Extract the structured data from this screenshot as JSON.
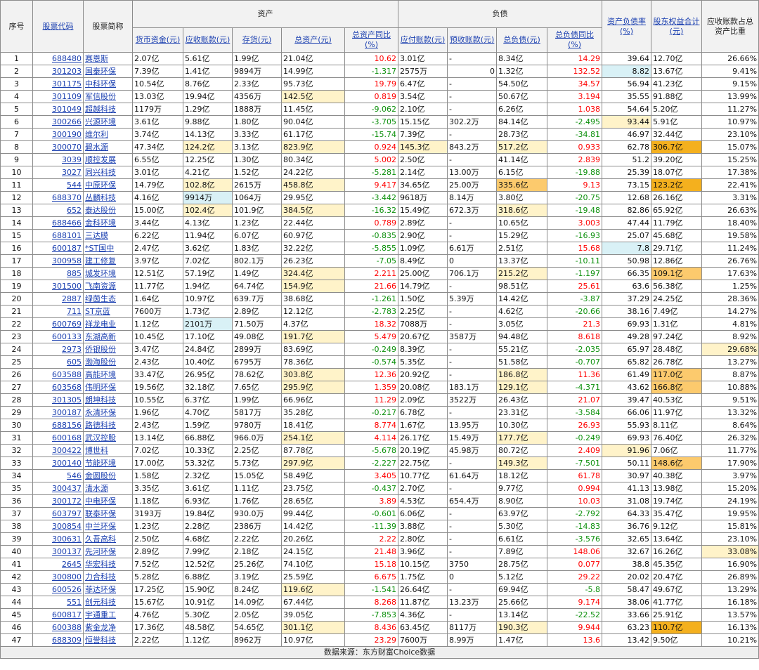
{
  "header": {
    "seq": "序号",
    "code": "股票代码",
    "name": "股票简称",
    "group_assets": "资产",
    "group_liab": "负债",
    "debt_ratio": "资产负债率(%)",
    "equity_total": "股东权益合计(元)",
    "recv_ratio": "应收账款占总资产比重",
    "cols": [
      "货币资金(元)",
      "应收账款(元)",
      "存货(元)",
      "总资产(元)",
      "总资产同比(%)",
      "应付账款(元)",
      "预收账款(元)",
      "总负债(元)",
      "总负债同比(%)"
    ]
  },
  "footer": "数据来源：东方财富Choice数据",
  "colors": {
    "highlight_yellow": "#fff3c9",
    "highlight_orange": "#fcca6d",
    "highlight_dark_orange": "#f4b01e",
    "highlight_cyan": "#d9f1f6",
    "positive": "#ff0000",
    "negative": "#0a8f0a"
  },
  "rows": [
    {
      "seq": "1",
      "code": "688480",
      "name": "赛恩斯",
      "cash": "2.07亿",
      "recv": "5.61亿",
      "inv": "1.99亿",
      "ta": "21.04亿",
      "tay": "10.62",
      "ap": "3.01亿",
      "adv": "-",
      "tl": "8.34亿",
      "tly": "14.29",
      "dr": "39.64",
      "eq": "12.70亿",
      "rr": "26.66%"
    },
    {
      "seq": "2",
      "code": "301203",
      "name": "国泰环保",
      "cash": "7.39亿",
      "recv": "1.41亿",
      "inv": "9894万",
      "ta": "14.99亿",
      "tay": "-1.317",
      "ap": "2575万",
      "adv": "0",
      "tl": "1.32亿",
      "tly": "132.52",
      "dr": "8.82",
      "eq": "13.67亿",
      "rr": "9.41%"
    },
    {
      "seq": "3",
      "code": "301175",
      "name": "中科环保",
      "cash": "10.54亿",
      "recv": "8.76亿",
      "inv": "2.33亿",
      "ta": "95.73亿",
      "tay": "19.79",
      "ap": "6.47亿",
      "adv": "-",
      "tl": "54.50亿",
      "tly": "34.57",
      "dr": "56.94",
      "eq": "41.23亿",
      "rr": "9.15%"
    },
    {
      "seq": "4",
      "code": "301109",
      "name": "军信股份",
      "cash": "13.03亿",
      "recv": "19.94亿",
      "inv": "4356万",
      "ta": "142.5亿",
      "tay": "0.819",
      "ap": "3.54亿",
      "adv": "-",
      "tl": "50.67亿",
      "tly": "3.194",
      "dr": "35.55",
      "eq": "91.88亿",
      "rr": "13.99%"
    },
    {
      "seq": "5",
      "code": "301049",
      "name": "超越科技",
      "cash": "1179万",
      "recv": "1.29亿",
      "inv": "1888万",
      "ta": "11.45亿",
      "tay": "-9.062",
      "ap": "2.10亿",
      "adv": "-",
      "tl": "6.26亿",
      "tly": "1.038",
      "dr": "54.64",
      "eq": "5.20亿",
      "rr": "11.27%"
    },
    {
      "seq": "6",
      "code": "300266",
      "name": "兴源环境",
      "cash": "3.61亿",
      "recv": "9.88亿",
      "inv": "1.80亿",
      "ta": "90.04亿",
      "tay": "-3.705",
      "ap": "15.15亿",
      "adv": "302.2万",
      "tl": "84.14亿",
      "tly": "-2.495",
      "dr": "93.44",
      "eq": "5.91亿",
      "rr": "10.97%"
    },
    {
      "seq": "7",
      "code": "300190",
      "name": "维尔利",
      "cash": "3.74亿",
      "recv": "14.13亿",
      "inv": "3.33亿",
      "ta": "61.17亿",
      "tay": "-15.74",
      "ap": "7.39亿",
      "adv": "-",
      "tl": "28.73亿",
      "tly": "-34.81",
      "dr": "46.97",
      "eq": "32.44亿",
      "rr": "23.10%"
    },
    {
      "seq": "8",
      "code": "300070",
      "name": "碧水源",
      "cash": "47.34亿",
      "recv": "124.2亿",
      "inv": "3.13亿",
      "ta": "823.9亿",
      "tay": "0.924",
      "ap": "145.3亿",
      "adv": "843.2万",
      "tl": "517.2亿",
      "tly": "0.933",
      "dr": "62.78",
      "eq": "306.7亿",
      "rr": "15.07%"
    },
    {
      "seq": "9",
      "code": "3039",
      "name": "顺控发展",
      "cash": "6.55亿",
      "recv": "12.25亿",
      "inv": "1.30亿",
      "ta": "80.34亿",
      "tay": "5.002",
      "ap": "2.50亿",
      "adv": "-",
      "tl": "41.14亿",
      "tly": "2.839",
      "dr": "51.2",
      "eq": "39.20亿",
      "rr": "15.25%"
    },
    {
      "seq": "10",
      "code": "3027",
      "name": "同兴科技",
      "cash": "3.01亿",
      "recv": "4.21亿",
      "inv": "1.52亿",
      "ta": "24.22亿",
      "tay": "-5.281",
      "ap": "2.14亿",
      "adv": "13.00万",
      "tl": "6.15亿",
      "tly": "-19.88",
      "dr": "25.39",
      "eq": "18.07亿",
      "rr": "17.38%"
    },
    {
      "seq": "11",
      "code": "544",
      "name": "中原环保",
      "cash": "14.79亿",
      "recv": "102.8亿",
      "inv": "2615万",
      "ta": "458.8亿",
      "tay": "9.417",
      "ap": "34.65亿",
      "adv": "25.00万",
      "tl": "335.6亿",
      "tly": "9.13",
      "dr": "73.15",
      "eq": "123.2亿",
      "rr": "22.41%"
    },
    {
      "seq": "12",
      "code": "688370",
      "name": "丛麟科技",
      "cash": "4.16亿",
      "recv": "9914万",
      "inv": "1064万",
      "ta": "29.95亿",
      "tay": "-3.442",
      "ap": "9618万",
      "adv": "8.14万",
      "tl": "3.80亿",
      "tly": "-20.75",
      "dr": "12.68",
      "eq": "26.16亿",
      "rr": "3.31%"
    },
    {
      "seq": "13",
      "code": "652",
      "name": "泰达股份",
      "cash": "15.00亿",
      "recv": "102.4亿",
      "inv": "101.9亿",
      "ta": "384.5亿",
      "tay": "-16.32",
      "ap": "15.49亿",
      "adv": "672.3万",
      "tl": "318.6亿",
      "tly": "-19.48",
      "dr": "82.86",
      "eq": "65.92亿",
      "rr": "26.63%"
    },
    {
      "seq": "14",
      "code": "688466",
      "name": "金科环境",
      "cash": "3.44亿",
      "recv": "4.13亿",
      "inv": "1.23亿",
      "ta": "22.44亿",
      "tay": "0.789",
      "ap": "2.89亿",
      "adv": "-",
      "tl": "10.65亿",
      "tly": "3.003",
      "dr": "47.44",
      "eq": "11.79亿",
      "rr": "18.40%"
    },
    {
      "seq": "15",
      "code": "688101",
      "name": "三达膜",
      "cash": "6.22亿",
      "recv": "11.94亿",
      "inv": "6.07亿",
      "ta": "60.97亿",
      "tay": "-0.835",
      "ap": "2.90亿",
      "adv": "-",
      "tl": "15.29亿",
      "tly": "-16.93",
      "dr": "25.07",
      "eq": "45.68亿",
      "rr": "19.58%"
    },
    {
      "seq": "16",
      "code": "600187",
      "name": "*ST国中",
      "cash": "2.47亿",
      "recv": "3.62亿",
      "inv": "1.83亿",
      "ta": "32.22亿",
      "tay": "-5.855",
      "ap": "1.09亿",
      "adv": "6.61万",
      "tl": "2.51亿",
      "tly": "15.68",
      "dr": "7.8",
      "eq": "29.71亿",
      "rr": "11.24%"
    },
    {
      "seq": "17",
      "code": "300958",
      "name": "建工修复",
      "cash": "3.97亿",
      "recv": "7.02亿",
      "inv": "802.1万",
      "ta": "26.23亿",
      "tay": "-7.05",
      "ap": "8.49亿",
      "adv": "0",
      "tl": "13.37亿",
      "tly": "-10.11",
      "dr": "50.98",
      "eq": "12.86亿",
      "rr": "26.76%"
    },
    {
      "seq": "18",
      "code": "885",
      "name": "城发环境",
      "cash": "12.51亿",
      "recv": "57.19亿",
      "inv": "1.49亿",
      "ta": "324.4亿",
      "tay": "2.211",
      "ap": "25.00亿",
      "adv": "706.1万",
      "tl": "215.2亿",
      "tly": "-1.197",
      "dr": "66.35",
      "eq": "109.1亿",
      "rr": "17.63%"
    },
    {
      "seq": "19",
      "code": "301500",
      "name": "飞南资源",
      "cash": "11.77亿",
      "recv": "1.94亿",
      "inv": "64.74亿",
      "ta": "154.9亿",
      "tay": "21.66",
      "ap": "14.79亿",
      "adv": "-",
      "tl": "98.51亿",
      "tly": "25.61",
      "dr": "63.6",
      "eq": "56.38亿",
      "rr": "1.25%"
    },
    {
      "seq": "20",
      "code": "2887",
      "name": "绿茵生态",
      "cash": "1.64亿",
      "recv": "10.97亿",
      "inv": "639.7万",
      "ta": "38.68亿",
      "tay": "-1.261",
      "ap": "1.50亿",
      "adv": "5.39万",
      "tl": "14.42亿",
      "tly": "-3.87",
      "dr": "37.29",
      "eq": "24.25亿",
      "rr": "28.36%"
    },
    {
      "seq": "21",
      "code": "711",
      "name": "ST京蓝",
      "cash": "7600万",
      "recv": "1.73亿",
      "inv": "2.89亿",
      "ta": "12.12亿",
      "tay": "-2.783",
      "ap": "2.25亿",
      "adv": "-",
      "tl": "4.62亿",
      "tly": "-20.66",
      "dr": "38.16",
      "eq": "7.49亿",
      "rr": "14.27%"
    },
    {
      "seq": "22",
      "code": "600769",
      "name": "祥龙电业",
      "cash": "1.12亿",
      "recv": "2101万",
      "inv": "71.50万",
      "ta": "4.37亿",
      "tay": "18.32",
      "ap": "7088万",
      "adv": "-",
      "tl": "3.05亿",
      "tly": "21.3",
      "dr": "69.93",
      "eq": "1.31亿",
      "rr": "4.81%"
    },
    {
      "seq": "23",
      "code": "600133",
      "name": "东湖高新",
      "cash": "10.45亿",
      "recv": "17.10亿",
      "inv": "49.08亿",
      "ta": "191.7亿",
      "tay": "5.479",
      "ap": "20.67亿",
      "adv": "3587万",
      "tl": "94.48亿",
      "tly": "8.618",
      "dr": "49.28",
      "eq": "97.24亿",
      "rr": "8.92%"
    },
    {
      "seq": "24",
      "code": "2973",
      "name": "侨银股份",
      "cash": "3.47亿",
      "recv": "24.84亿",
      "inv": "2899万",
      "ta": "83.69亿",
      "tay": "-0.249",
      "ap": "8.39亿",
      "adv": "-",
      "tl": "55.21亿",
      "tly": "-2.035",
      "dr": "65.97",
      "eq": "28.48亿",
      "rr": "29.68%"
    },
    {
      "seq": "25",
      "code": "605",
      "name": "渤海股份",
      "cash": "2.43亿",
      "recv": "10.40亿",
      "inv": "6795万",
      "ta": "78.36亿",
      "tay": "-0.574",
      "ap": "5.35亿",
      "adv": "-",
      "tl": "51.58亿",
      "tly": "-0.707",
      "dr": "65.82",
      "eq": "26.78亿",
      "rr": "13.27%"
    },
    {
      "seq": "26",
      "code": "603588",
      "name": "高能环境",
      "cash": "33.47亿",
      "recv": "26.95亿",
      "inv": "78.62亿",
      "ta": "303.8亿",
      "tay": "12.36",
      "ap": "20.92亿",
      "adv": "-",
      "tl": "186.8亿",
      "tly": "11.36",
      "dr": "61.49",
      "eq": "117.0亿",
      "rr": "8.87%"
    },
    {
      "seq": "27",
      "code": "603568",
      "name": "伟明环保",
      "cash": "19.56亿",
      "recv": "32.18亿",
      "inv": "7.65亿",
      "ta": "295.9亿",
      "tay": "1.359",
      "ap": "20.08亿",
      "adv": "183.1万",
      "tl": "129.1亿",
      "tly": "-4.371",
      "dr": "43.62",
      "eq": "166.8亿",
      "rr": "10.88%"
    },
    {
      "seq": "28",
      "code": "301305",
      "name": "朗坤科技",
      "cash": "10.55亿",
      "recv": "6.37亿",
      "inv": "1.99亿",
      "ta": "66.96亿",
      "tay": "11.29",
      "ap": "2.09亿",
      "adv": "3522万",
      "tl": "26.43亿",
      "tly": "21.07",
      "dr": "39.47",
      "eq": "40.53亿",
      "rr": "9.51%"
    },
    {
      "seq": "29",
      "code": "300187",
      "name": "永清环保",
      "cash": "1.96亿",
      "recv": "4.70亿",
      "inv": "5817万",
      "ta": "35.28亿",
      "tay": "-0.217",
      "ap": "6.78亿",
      "adv": "-",
      "tl": "23.31亿",
      "tly": "-3.584",
      "dr": "66.06",
      "eq": "11.97亿",
      "rr": "13.32%"
    },
    {
      "seq": "30",
      "code": "688156",
      "name": "路德科技",
      "cash": "2.43亿",
      "recv": "1.59亿",
      "inv": "9780万",
      "ta": "18.41亿",
      "tay": "8.774",
      "ap": "1.67亿",
      "adv": "13.95万",
      "tl": "10.30亿",
      "tly": "26.93",
      "dr": "55.93",
      "eq": "8.11亿",
      "rr": "8.64%"
    },
    {
      "seq": "31",
      "code": "600168",
      "name": "武汉控股",
      "cash": "13.14亿",
      "recv": "66.88亿",
      "inv": "966.0万",
      "ta": "254.1亿",
      "tay": "4.114",
      "ap": "26.17亿",
      "adv": "15.49万",
      "tl": "177.7亿",
      "tly": "-0.249",
      "dr": "69.93",
      "eq": "76.40亿",
      "rr": "26.32%"
    },
    {
      "seq": "32",
      "code": "300422",
      "name": "博世科",
      "cash": "7.02亿",
      "recv": "10.33亿",
      "inv": "2.25亿",
      "ta": "87.78亿",
      "tay": "-5.678",
      "ap": "20.19亿",
      "adv": "45.98万",
      "tl": "80.72亿",
      "tly": "2.409",
      "dr": "91.96",
      "eq": "7.06亿",
      "rr": "11.77%"
    },
    {
      "seq": "33",
      "code": "300140",
      "name": "节能环境",
      "cash": "17.00亿",
      "recv": "53.32亿",
      "inv": "5.73亿",
      "ta": "297.9亿",
      "tay": "-2.227",
      "ap": "22.75亿",
      "adv": "-",
      "tl": "149.3亿",
      "tly": "-7.501",
      "dr": "50.11",
      "eq": "148.6亿",
      "rr": "17.90%"
    },
    {
      "seq": "34",
      "code": "546",
      "name": "金圆股份",
      "cash": "1.58亿",
      "recv": "2.32亿",
      "inv": "15.05亿",
      "ta": "58.49亿",
      "tay": "3.405",
      "ap": "10.77亿",
      "adv": "61.64万",
      "tl": "18.12亿",
      "tly": "61.78",
      "dr": "30.97",
      "eq": "40.38亿",
      "rr": "3.97%"
    },
    {
      "seq": "35",
      "code": "300437",
      "name": "清水源",
      "cash": "3.35亿",
      "recv": "3.61亿",
      "inv": "1.11亿",
      "ta": "23.75亿",
      "tay": "-0.437",
      "ap": "2.70亿",
      "adv": "-",
      "tl": "9.77亿",
      "tly": "0.994",
      "dr": "41.13",
      "eq": "13.98亿",
      "rr": "15.20%"
    },
    {
      "seq": "36",
      "code": "300172",
      "name": "中电环保",
      "cash": "1.18亿",
      "recv": "6.93亿",
      "inv": "1.76亿",
      "ta": "28.65亿",
      "tay": "3.89",
      "ap": "4.53亿",
      "adv": "654.4万",
      "tl": "8.90亿",
      "tly": "10.03",
      "dr": "31.08",
      "eq": "19.74亿",
      "rr": "24.19%"
    },
    {
      "seq": "37",
      "code": "603797",
      "name": "联泰环保",
      "cash": "3193万",
      "recv": "19.84亿",
      "inv": "930.0万",
      "ta": "99.44亿",
      "tay": "-0.601",
      "ap": "6.06亿",
      "adv": "-",
      "tl": "63.97亿",
      "tly": "-2.792",
      "dr": "64.33",
      "eq": "35.47亿",
      "rr": "19.95%"
    },
    {
      "seq": "38",
      "code": "300854",
      "name": "中兰环保",
      "cash": "1.23亿",
      "recv": "2.28亿",
      "inv": "2386万",
      "ta": "14.42亿",
      "tay": "-11.39",
      "ap": "3.88亿",
      "adv": "-",
      "tl": "5.30亿",
      "tly": "-14.83",
      "dr": "36.76",
      "eq": "9.12亿",
      "rr": "15.81%"
    },
    {
      "seq": "39",
      "code": "300631",
      "name": "久吾高科",
      "cash": "2.50亿",
      "recv": "4.68亿",
      "inv": "2.22亿",
      "ta": "20.26亿",
      "tay": "2.22",
      "ap": "2.80亿",
      "adv": "-",
      "tl": "6.61亿",
      "tly": "-3.576",
      "dr": "32.65",
      "eq": "13.64亿",
      "rr": "23.10%"
    },
    {
      "seq": "40",
      "code": "300137",
      "name": "先河环保",
      "cash": "2.89亿",
      "recv": "7.99亿",
      "inv": "2.18亿",
      "ta": "24.15亿",
      "tay": "21.48",
      "ap": "3.96亿",
      "adv": "-",
      "tl": "7.89亿",
      "tly": "148.06",
      "dr": "32.67",
      "eq": "16.26亿",
      "rr": "33.08%"
    },
    {
      "seq": "41",
      "code": "2645",
      "name": "华宏科技",
      "cash": "7.52亿",
      "recv": "12.52亿",
      "inv": "25.26亿",
      "ta": "74.10亿",
      "tay": "15.18",
      "ap": "10.15亿",
      "adv": "3750",
      "tl": "28.75亿",
      "tly": "0.077",
      "dr": "38.8",
      "eq": "45.35亿",
      "rr": "16.90%"
    },
    {
      "seq": "42",
      "code": "300800",
      "name": "力合科技",
      "cash": "5.28亿",
      "recv": "6.88亿",
      "inv": "3.19亿",
      "ta": "25.59亿",
      "tay": "6.675",
      "ap": "1.75亿",
      "adv": "0",
      "tl": "5.12亿",
      "tly": "29.22",
      "dr": "20.02",
      "eq": "20.47亿",
      "rr": "26.89%"
    },
    {
      "seq": "43",
      "code": "600526",
      "name": "菲达环保",
      "cash": "17.25亿",
      "recv": "15.90亿",
      "inv": "8.24亿",
      "ta": "119.6亿",
      "tay": "-1.541",
      "ap": "26.64亿",
      "adv": "-",
      "tl": "69.94亿",
      "tly": "-5.8",
      "dr": "58.47",
      "eq": "49.67亿",
      "rr": "13.29%"
    },
    {
      "seq": "44",
      "code": "551",
      "name": "创元科技",
      "cash": "15.67亿",
      "recv": "10.91亿",
      "inv": "14.09亿",
      "ta": "67.44亿",
      "tay": "8.268",
      "ap": "11.87亿",
      "adv": "13.23万",
      "tl": "25.66亿",
      "tly": "9.174",
      "dr": "38.06",
      "eq": "41.77亿",
      "rr": "16.18%"
    },
    {
      "seq": "45",
      "code": "600817",
      "name": "宇通重工",
      "cash": "4.76亿",
      "recv": "5.30亿",
      "inv": "2.05亿",
      "ta": "39.05亿",
      "tay": "-7.853",
      "ap": "4.36亿",
      "adv": "-",
      "tl": "13.14亿",
      "tly": "-22.52",
      "dr": "33.66",
      "eq": "25.91亿",
      "rr": "13.57%"
    },
    {
      "seq": "46",
      "code": "600388",
      "name": "紫金龙净",
      "cash": "17.36亿",
      "recv": "48.58亿",
      "inv": "54.65亿",
      "ta": "301.1亿",
      "tay": "8.436",
      "ap": "63.45亿",
      "adv": "8117万",
      "tl": "190.3亿",
      "tly": "9.944",
      "dr": "63.23",
      "eq": "110.7亿",
      "rr": "16.13%"
    },
    {
      "seq": "47",
      "code": "688309",
      "name": "恒誉科技",
      "cash": "2.22亿",
      "recv": "1.12亿",
      "inv": "8962万",
      "ta": "10.97亿",
      "tay": "23.29",
      "ap": "7600万",
      "adv": "8.99万",
      "tl": "1.47亿",
      "tly": "13.6",
      "dr": "13.42",
      "eq": "9.50亿",
      "rr": "10.21%"
    }
  ]
}
